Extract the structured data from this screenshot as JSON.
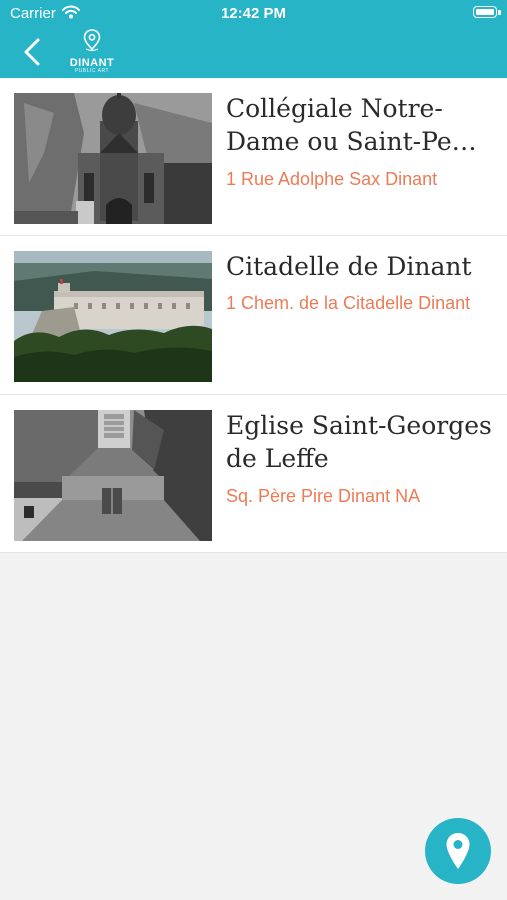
{
  "status_bar": {
    "carrier": "Carrier",
    "time": "12:42 PM"
  },
  "header": {
    "logo_title": "DINANT",
    "logo_subtitle": "PUBLIC ART"
  },
  "places": [
    {
      "name": "Collégiale Notre-Dame ou Saint-Pe…",
      "address": "1 Rue Adolphe Sax Dinant"
    },
    {
      "name": "Citadelle de Dinant",
      "address": "1 Chem. de la Citadelle Dinant"
    },
    {
      "name": "Eglise Saint-Georges de Leffe",
      "address": "Sq. Père Pire Dinant NA"
    }
  ],
  "colors": {
    "header": "#27b4c6",
    "address": "#ec7b55",
    "background": "#f2f2f2"
  },
  "icons": {
    "back": "chevron-left-icon",
    "logo": "map-pin-icon",
    "fab": "map-pin-icon"
  }
}
